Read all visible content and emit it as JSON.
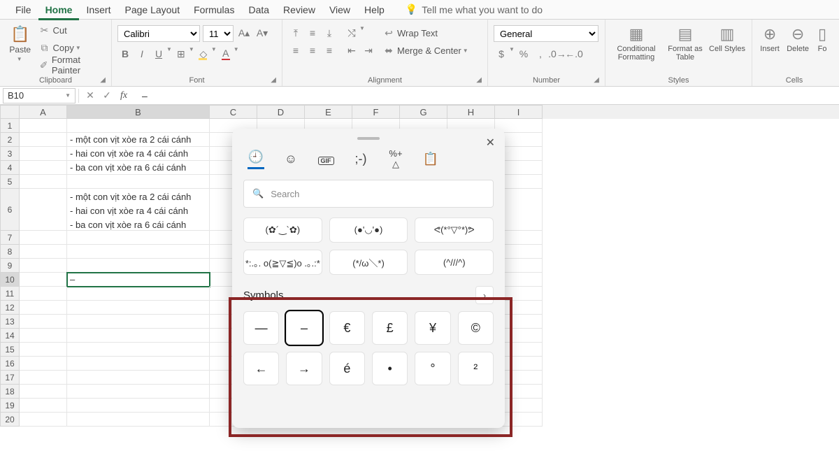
{
  "tabs": [
    "File",
    "Home",
    "Insert",
    "Page Layout",
    "Formulas",
    "Data",
    "Review",
    "View",
    "Help"
  ],
  "active_tab": "Home",
  "tellme": "Tell me what you want to do",
  "clipboard": {
    "paste": "Paste",
    "cut": "Cut",
    "copy": "Copy",
    "painter": "Format Painter",
    "label": "Clipboard"
  },
  "font": {
    "name": "Calibri",
    "size": "11",
    "label": "Font"
  },
  "alignment": {
    "wrap": "Wrap Text",
    "merge": "Merge & Center",
    "label": "Alignment"
  },
  "number": {
    "format": "General",
    "label": "Number"
  },
  "styles": {
    "cond": "Conditional Formatting",
    "table": "Format as Table",
    "cell": "Cell Styles",
    "label": "Styles"
  },
  "cells": {
    "insert": "Insert",
    "delete": "Delete",
    "format": "Fo",
    "label": "Cells"
  },
  "namebox": "B10",
  "formula_value": "–",
  "columns": [
    "A",
    "B",
    "C",
    "D",
    "E",
    "F",
    "G",
    "H",
    "I"
  ],
  "rows_count": 20,
  "cell_data": {
    "B2": "- một con vịt xòe ra 2 cái cánh",
    "B3": "- hai con vịt xòe ra 4 cái cánh",
    "B4": "- ba con vịt xòe ra 6 cái cánh",
    "B6": "- một con vịt xòe ra 2 cái cánh\n- hai con vịt xòe ra 4 cái cánh\n- ba con vịt xòe ra 6 cái cánh",
    "B10": "–"
  },
  "active_cell": "B10",
  "panel": {
    "search_placeholder": "Search",
    "kaomoji_row1": [
      "(✿´‿`✿)",
      "(●'◡'●)",
      "ᕙ(*°▽°*)ᕗ"
    ],
    "kaomoji_row2": [
      "*:.｡. o(≧▽≦)o .｡.:*",
      "(*/ω＼*)",
      "(^///^)"
    ],
    "symbols_title": "Symbols",
    "symbols_row1": [
      "—",
      "–",
      "€",
      "£",
      "¥",
      "©"
    ],
    "symbols_row2": [
      "←",
      "→",
      "é",
      "•",
      "°",
      "²"
    ],
    "selected_symbol_index": 1
  }
}
